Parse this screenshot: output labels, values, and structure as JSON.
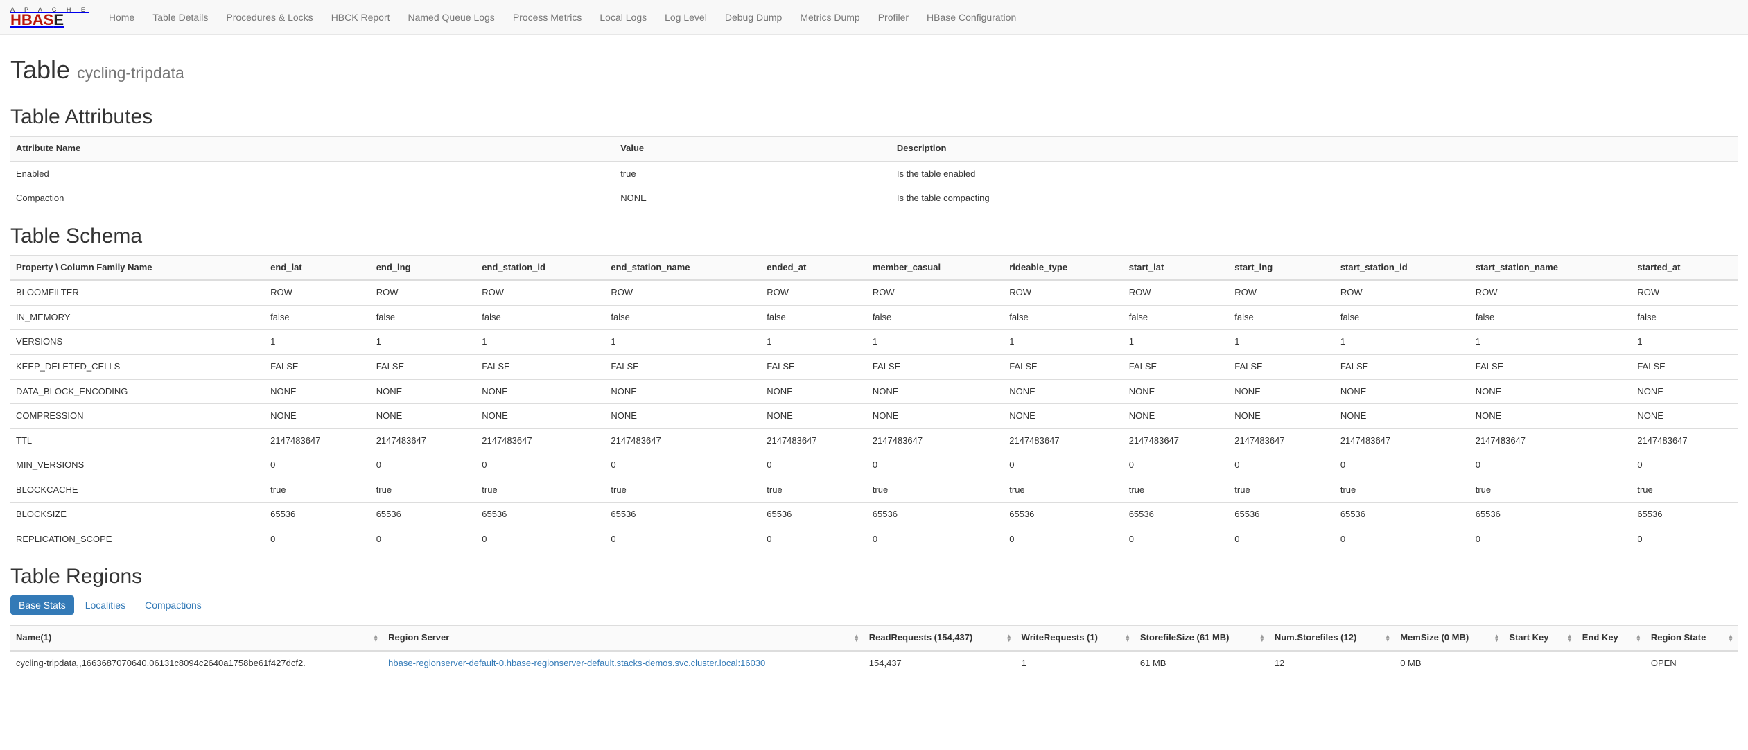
{
  "nav": {
    "brand_top": "A P A C H E",
    "brand_main1": "HBAS",
    "brand_main2": "E",
    "items": [
      "Home",
      "Table Details",
      "Procedures & Locks",
      "HBCK Report",
      "Named Queue Logs",
      "Process Metrics",
      "Local Logs",
      "Log Level",
      "Debug Dump",
      "Metrics Dump",
      "Profiler",
      "HBase Configuration"
    ]
  },
  "header": {
    "title": "Table",
    "subtitle": "cycling-tripdata"
  },
  "attributes": {
    "heading": "Table Attributes",
    "columns": [
      "Attribute Name",
      "Value",
      "Description"
    ],
    "rows": [
      {
        "name": "Enabled",
        "value": "true",
        "desc": "Is the table enabled"
      },
      {
        "name": "Compaction",
        "value": "NONE",
        "desc": "Is the table compacting"
      }
    ]
  },
  "schema": {
    "heading": "Table Schema",
    "prop_col": "Property \\ Column Family Name",
    "families": [
      "end_lat",
      "end_lng",
      "end_station_id",
      "end_station_name",
      "ended_at",
      "member_casual",
      "rideable_type",
      "start_lat",
      "start_lng",
      "start_station_id",
      "start_station_name",
      "started_at"
    ],
    "rows": [
      {
        "prop": "BLOOMFILTER",
        "vals": [
          "ROW",
          "ROW",
          "ROW",
          "ROW",
          "ROW",
          "ROW",
          "ROW",
          "ROW",
          "ROW",
          "ROW",
          "ROW",
          "ROW"
        ]
      },
      {
        "prop": "IN_MEMORY",
        "vals": [
          "false",
          "false",
          "false",
          "false",
          "false",
          "false",
          "false",
          "false",
          "false",
          "false",
          "false",
          "false"
        ]
      },
      {
        "prop": "VERSIONS",
        "vals": [
          "1",
          "1",
          "1",
          "1",
          "1",
          "1",
          "1",
          "1",
          "1",
          "1",
          "1",
          "1"
        ]
      },
      {
        "prop": "KEEP_DELETED_CELLS",
        "vals": [
          "FALSE",
          "FALSE",
          "FALSE",
          "FALSE",
          "FALSE",
          "FALSE",
          "FALSE",
          "FALSE",
          "FALSE",
          "FALSE",
          "FALSE",
          "FALSE"
        ]
      },
      {
        "prop": "DATA_BLOCK_ENCODING",
        "vals": [
          "NONE",
          "NONE",
          "NONE",
          "NONE",
          "NONE",
          "NONE",
          "NONE",
          "NONE",
          "NONE",
          "NONE",
          "NONE",
          "NONE"
        ]
      },
      {
        "prop": "COMPRESSION",
        "vals": [
          "NONE",
          "NONE",
          "NONE",
          "NONE",
          "NONE",
          "NONE",
          "NONE",
          "NONE",
          "NONE",
          "NONE",
          "NONE",
          "NONE"
        ]
      },
      {
        "prop": "TTL",
        "vals": [
          "2147483647",
          "2147483647",
          "2147483647",
          "2147483647",
          "2147483647",
          "2147483647",
          "2147483647",
          "2147483647",
          "2147483647",
          "2147483647",
          "2147483647",
          "2147483647"
        ]
      },
      {
        "prop": "MIN_VERSIONS",
        "vals": [
          "0",
          "0",
          "0",
          "0",
          "0",
          "0",
          "0",
          "0",
          "0",
          "0",
          "0",
          "0"
        ]
      },
      {
        "prop": "BLOCKCACHE",
        "vals": [
          "true",
          "true",
          "true",
          "true",
          "true",
          "true",
          "true",
          "true",
          "true",
          "true",
          "true",
          "true"
        ]
      },
      {
        "prop": "BLOCKSIZE",
        "vals": [
          "65536",
          "65536",
          "65536",
          "65536",
          "65536",
          "65536",
          "65536",
          "65536",
          "65536",
          "65536",
          "65536",
          "65536"
        ]
      },
      {
        "prop": "REPLICATION_SCOPE",
        "vals": [
          "0",
          "0",
          "0",
          "0",
          "0",
          "0",
          "0",
          "0",
          "0",
          "0",
          "0",
          "0"
        ]
      }
    ]
  },
  "regions": {
    "heading": "Table Regions",
    "tabs": [
      "Base Stats",
      "Localities",
      "Compactions"
    ],
    "columns": [
      "Name(1)",
      "Region Server",
      "ReadRequests (154,437)",
      "WriteRequests (1)",
      "StorefileSize (61 MB)",
      "Num.Storefiles (12)",
      "MemSize (0 MB)",
      "Start Key",
      "End Key",
      "Region State"
    ],
    "rows": [
      {
        "name": "cycling-tripdata,,1663687070640.06131c8094c2640a1758be61f427dcf2.",
        "server": "hbase-regionserver-default-0.hbase-regionserver-default.stacks-demos.svc.cluster.local:16030",
        "read": "154,437",
        "write": "1",
        "storesize": "61 MB",
        "numstore": "12",
        "memsize": "0 MB",
        "startkey": "",
        "endkey": "",
        "state": "OPEN"
      }
    ]
  }
}
